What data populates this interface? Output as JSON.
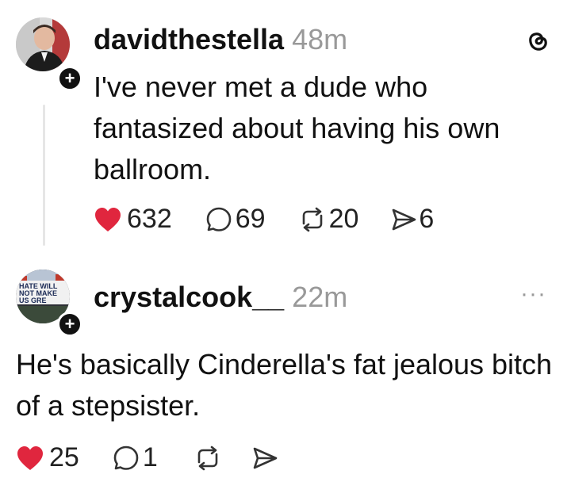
{
  "post1": {
    "username": "davidthestella",
    "time": "48m",
    "text": "I've never met a dude who fantasized about having his own ballroom.",
    "likes": "632",
    "comments": "69",
    "reposts": "20",
    "shares": "6",
    "icon": "threads-logo-icon"
  },
  "post2": {
    "username": "crystalcook__",
    "time": "22m",
    "avatar_text": "HATE WILL NOT MAKE US GRE",
    "text": "He's basically Cinderella's fat jealous bitch of a stepsister.",
    "likes": "25",
    "comments": "1",
    "more": "···"
  }
}
